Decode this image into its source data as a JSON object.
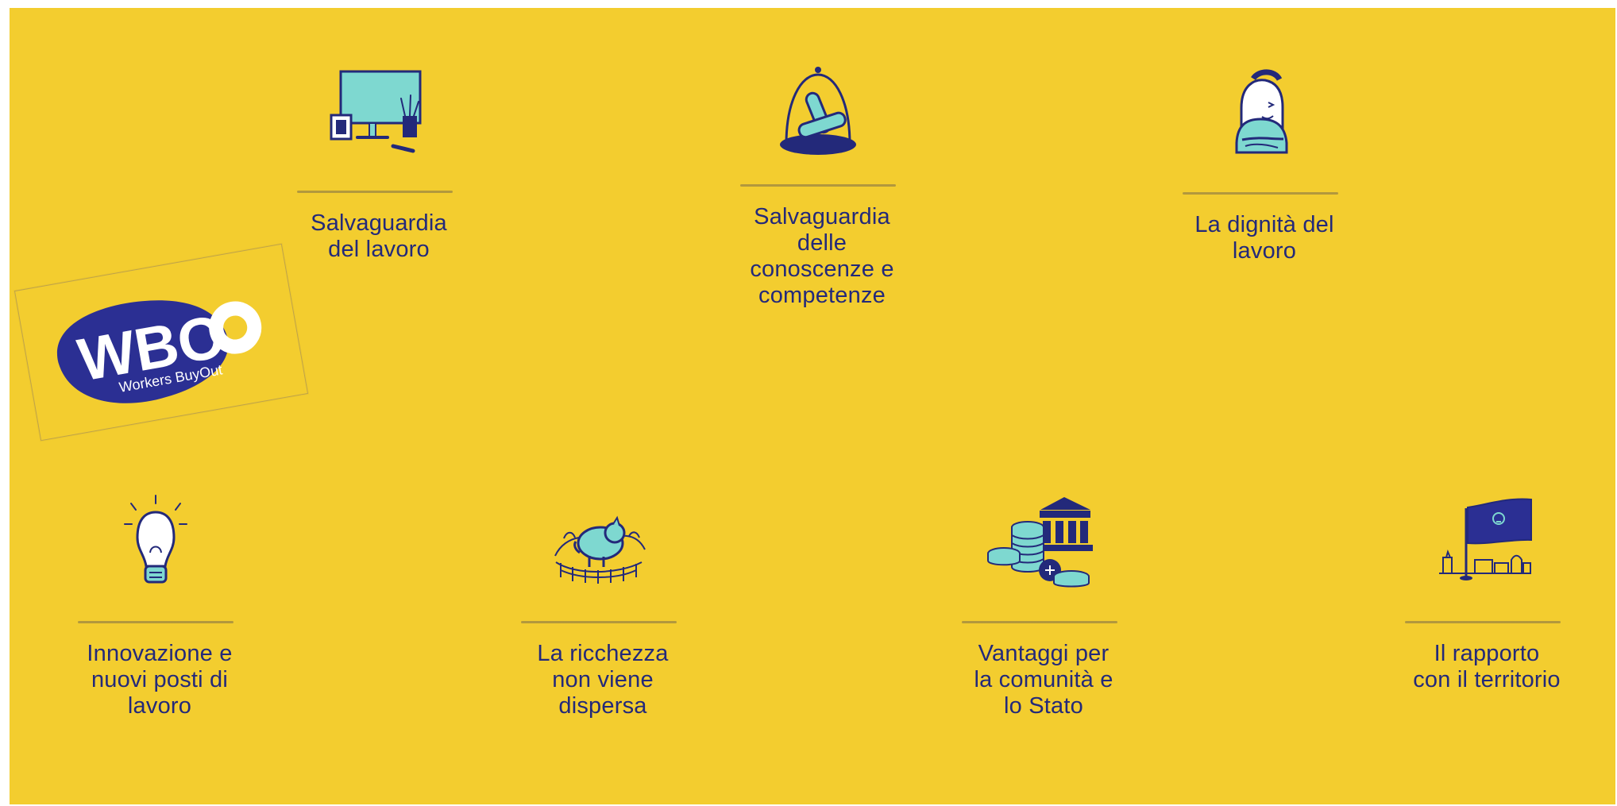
{
  "features": [
    {
      "label_lines": [
        "Salvaguardia",
        "del lavoro"
      ],
      "icon": "computer-desk-icon"
    },
    {
      "label_lines": [
        "Salvaguardia",
        "delle",
        "conoscenze e",
        "competenze"
      ],
      "icon": "scrolls-under-glass-icon"
    },
    {
      "label_lines": [
        "La dignità del",
        "lavoro"
      ],
      "icon": "worker-portrait-icon"
    },
    {
      "label_lines": [
        "Innovazione e",
        "nuovi posti di",
        "lavoro"
      ],
      "icon": "lightbulb-icon"
    },
    {
      "label_lines": [
        "La ricchezza",
        "non viene",
        "dispersa"
      ],
      "icon": "piggy-bank-icon"
    },
    {
      "label_lines": [
        "Vantaggi per",
        "la comunità e",
        "lo Stato"
      ],
      "icon": "bank-coins-icon"
    },
    {
      "label_lines": [
        "Il rapporto",
        "con il territorio"
      ],
      "icon": "flag-town-icon"
    }
  ],
  "logo": {
    "text": "WBO",
    "subtitle": "Workers BuyOut"
  },
  "colors": {
    "background": "#f3cd2f",
    "navy": "#23297a",
    "teal": "#7ed8d0"
  }
}
